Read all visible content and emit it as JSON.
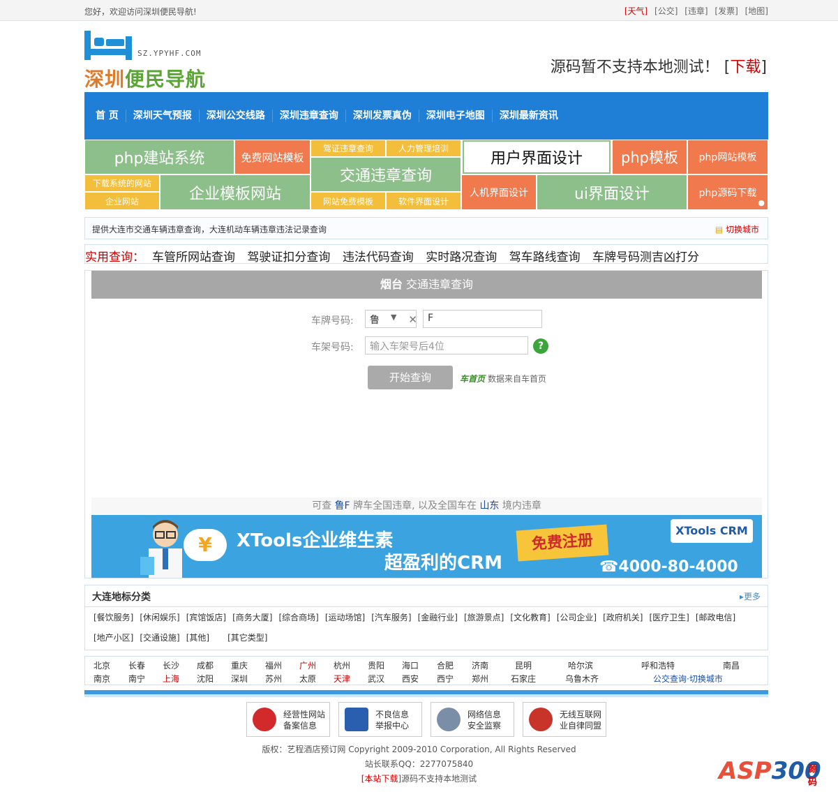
{
  "topbar": {
    "welcome": "您好，欢迎访问深圳便民导航!",
    "links": [
      "[天气]",
      "[公交]",
      "[违章]",
      "[发票]",
      "[地图]"
    ]
  },
  "logo": {
    "domain": "SZ.YPYHF.COM",
    "name_part1": "深圳",
    "name_part2": "便民导航"
  },
  "slogan": {
    "text": "源码暂不支持本地测试！",
    "bracket_open": "[",
    "download": "下载",
    "bracket_close": "]"
  },
  "nav": [
    "首 页",
    "深圳天气预报",
    "深圳公交线路",
    "深圳违章查询",
    "深圳发票真伪",
    "深圳电子地图",
    "深圳最新资讯"
  ],
  "tiles": {
    "t1": "php建站系统",
    "t2": "免费网站模板",
    "t3": "驾证违章查询",
    "t4": "人力管理培训",
    "t5": "用户界面设计",
    "t6": "php模板",
    "t7": "php网站模板",
    "t8": "交通违章查询",
    "t9": "下载系统的网站",
    "t10": "企业网站",
    "t11": "企业模板网站",
    "t12": "网站免费模板",
    "t13": "软件界面设计",
    "t14": "人机界面设计",
    "t15": "ui界面设计",
    "t16": "php源码下载"
  },
  "infobar": {
    "text": "提供大连市交通车辆违章查询，大连机动车辆违章违法记录查询",
    "switch": "切换城市"
  },
  "quick": {
    "label": "实用查询：",
    "items": [
      "车管所网站查询",
      "驾驶证扣分查询",
      "违法代码查询",
      "实时路况查询",
      "驾车路线查询",
      "车牌号码测吉凶打分"
    ]
  },
  "query": {
    "city": "烟台",
    "title": "交通违章查询",
    "plate_label": "车牌号码:",
    "province": "鲁",
    "plate_value": "F",
    "frame_label": "车架号码:",
    "frame_placeholder": "输入车架号后4位",
    "help": "?",
    "submit": "开始查询",
    "source_logo": "车首页",
    "source_text": "数据来自车首页",
    "foot_pre": "可查",
    "foot_plate": "鲁F",
    "foot_mid": "牌车全国违章, 以及全国车在",
    "foot_region": "山东",
    "foot_post": "境内违章"
  },
  "banner": {
    "line1": "XTools企业维生素",
    "line2": "超盈利的CRM",
    "register": "免费注册",
    "brand": "XTools CRM",
    "phone": "4000-80-4000",
    "cloud_symbol": "¥"
  },
  "landmarks": {
    "title": "大连地标分类",
    "more": "更多",
    "row1": [
      "[餐饮服务]",
      "[休闲娱乐]",
      "[宾馆饭店]",
      "[商务大厦]",
      "[综合商场]",
      "[运动场馆]",
      "[汽车服务]",
      "[金融行业]",
      "[旅游景点]",
      "[文化教育]",
      "[公司企业]",
      "[政府机关]",
      "[医疗卫生]",
      "[邮政电信]"
    ],
    "row2": [
      "[地产小区]",
      "[交通设施]",
      "[其他]",
      "[其它类型]"
    ]
  },
  "cities": {
    "row1": [
      "北京",
      "长春",
      "长沙",
      "成都",
      "重庆",
      "福州",
      "广州",
      "杭州",
      "贵阳",
      "海口",
      "合肥",
      "济南",
      "昆明",
      "哈尔滨",
      "呼和浩特",
      "南昌"
    ],
    "row2": [
      "南京",
      "南宁",
      "上海",
      "沈阳",
      "深圳",
      "苏州",
      "太原",
      "天津",
      "武汉",
      "西安",
      "西宁",
      "郑州",
      "石家庄",
      "乌鲁木齐"
    ],
    "switch": "公交查询·切换城市",
    "highlight_color": "#cc0000"
  },
  "badges": [
    {
      "line1": "经营性网站",
      "line2": "备案信息"
    },
    {
      "line1": "不良信息",
      "line2": "举报中心"
    },
    {
      "line1": "网络信息",
      "line2": "安全监察"
    },
    {
      "line1": "无线互联网",
      "line2": "业自律同盟"
    }
  ],
  "footer": {
    "copyright": "版权：艺程酒店预订网 Copyright 2009-2010 Corporation, All Rights Reserved",
    "qq": "站长联系QQ：2277075840",
    "dl_open": "[",
    "dl_link": "本站下载",
    "dl_close": "]源码不支持本地测试"
  },
  "watermark": {
    "a": "ASP",
    "b": "300",
    "c": "源码"
  },
  "colors": {
    "nav_blue": "#1f7fd6",
    "tile_green": "#8cbf8a",
    "tile_orange": "#f0794d",
    "tile_yellow": "#f2be3c",
    "accent_red": "#cc0000"
  }
}
